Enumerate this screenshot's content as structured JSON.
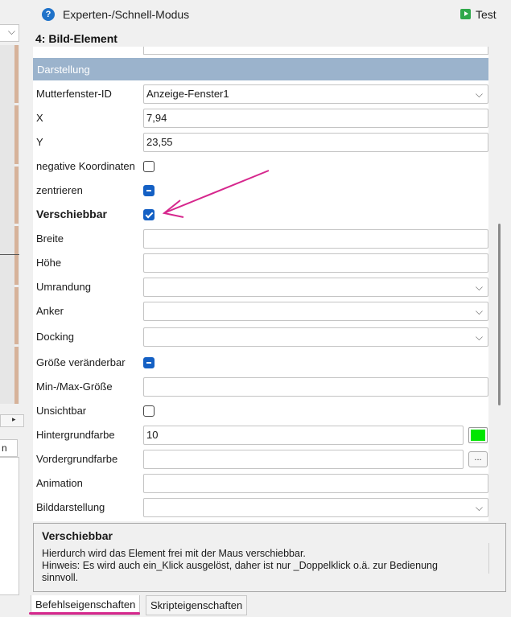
{
  "header": {
    "mode_label": "Experten-/Schnell-Modus",
    "test_label": "Test",
    "element_title": "4: Bild-Element",
    "help_icon": "?"
  },
  "left_pane": {
    "combo_caret": "⌵",
    "scroll_arrow": "▸",
    "tab_label": "n"
  },
  "section": {
    "title": "Darstellung"
  },
  "properties": [
    {
      "label": "Mutterfenster-ID",
      "type": "dropdown",
      "value": "Anzeige-Fenster1"
    },
    {
      "label": "X",
      "type": "text",
      "value": "7,94"
    },
    {
      "label": "Y",
      "type": "text",
      "value": "23,55"
    },
    {
      "label": "negative Koordinaten",
      "type": "checkbox",
      "state": "unchecked"
    },
    {
      "label": "zentrieren",
      "type": "checkbox",
      "state": "indeterminate"
    },
    {
      "label": "Verschiebbar",
      "type": "checkbox",
      "state": "checked",
      "bold": true
    },
    {
      "label": "Breite",
      "type": "text",
      "value": ""
    },
    {
      "label": "Höhe",
      "type": "text",
      "value": ""
    },
    {
      "label": "Umrandung",
      "type": "dropdown",
      "value": ""
    },
    {
      "label": "Anker",
      "type": "dropdown",
      "value": ""
    },
    {
      "label": "Docking",
      "type": "dropdown",
      "value": ""
    },
    {
      "label": "Größe veränderbar",
      "type": "checkbox",
      "state": "indeterminate"
    },
    {
      "label": "Min-/Max-Größe",
      "type": "text",
      "value": ""
    },
    {
      "label": "Unsichtbar",
      "type": "checkbox",
      "state": "unchecked"
    },
    {
      "label": "Hintergrundfarbe",
      "type": "color",
      "value": "10",
      "swatch": "#00e600"
    },
    {
      "label": "Vordergrundfarbe",
      "type": "browse",
      "value": "",
      "button": "..."
    },
    {
      "label": "Animation",
      "type": "text",
      "value": ""
    },
    {
      "label": "Bilddarstellung",
      "type": "dropdown",
      "value": ""
    }
  ],
  "description": {
    "title": "Verschiebbar",
    "lines": [
      "Hierdurch wird das Element frei mit der Maus verschiebbar.",
      "Hinweis: Es wird auch ein_Klick ausgelöst, daher ist nur _Doppelklick o.ä. zur Bedienung",
      "sinnvoll."
    ]
  },
  "tabs": [
    {
      "label": "Befehlseigenschaften",
      "active": true
    },
    {
      "label": "Skripteigenschaften",
      "active": false
    }
  ],
  "colors": {
    "section_header": "#9bb3cc",
    "checkbox_accent": "#1460c4",
    "annotation": "#d6278d",
    "test_icon": "#2fa84a"
  },
  "icons": {
    "dropdown_caret": "⌵",
    "help": "help-icon",
    "test": "play-icon"
  }
}
